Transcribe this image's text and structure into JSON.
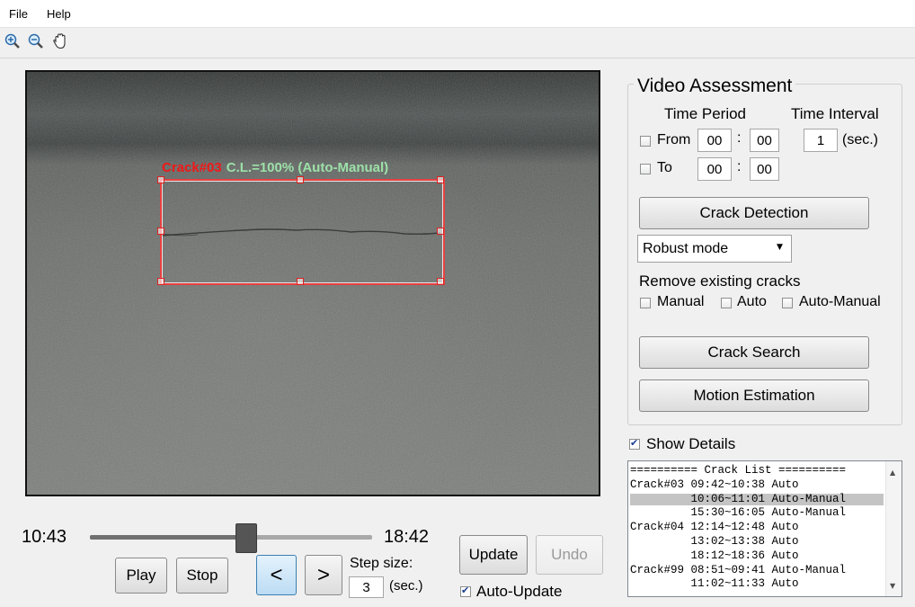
{
  "menu": {
    "file": "File",
    "help": "Help"
  },
  "toolbar": {
    "zoom_in": "zoom-in-icon",
    "zoom_out": "zoom-out-icon",
    "pan": "hand-pan-icon"
  },
  "video": {
    "overlay_id": "Crack#03",
    "overlay_cl": "C.L.=100% (Auto-Manual)",
    "overlay_color_id": "#f01818",
    "overlay_color_cl": "#9ce0a8"
  },
  "playback": {
    "current_time": "10:43",
    "end_time": "18:42",
    "slider_position": 0.55,
    "play": "Play",
    "stop": "Stop",
    "prev": "<",
    "next": ">",
    "step_label": "Step size:",
    "step_value": "3",
    "step_unit": "(sec.)",
    "update": "Update",
    "undo": "Undo",
    "auto_update": "Auto-Update",
    "auto_update_checked": true
  },
  "assessment": {
    "title": "Video Assessment",
    "time_period": "Time Period",
    "time_interval": "Time Interval",
    "from_label": "From",
    "from_min": "00",
    "from_sec": "00",
    "to_label": "To",
    "to_min": "00",
    "to_sec": "00",
    "colon": ":",
    "interval_value": "1",
    "interval_unit": "(sec.)",
    "crack_detection": "Crack Detection",
    "mode_selected": "Robust mode",
    "remove_label": "Remove existing cracks",
    "remove_manual": "Manual",
    "remove_auto": "Auto",
    "remove_auto_manual": "Auto-Manual",
    "crack_search": "Crack Search",
    "motion_estimation": "Motion Estimation"
  },
  "details": {
    "show_details": "Show Details",
    "show_details_checked": true,
    "rows": [
      "========== Crack List ==========",
      "Crack#03 09:42~10:38 Auto",
      "         10:06~11:01 Auto-Manual",
      "         15:30~16:05 Auto-Manual",
      "Crack#04 12:14~12:48 Auto",
      "         13:02~13:38 Auto",
      "         18:12~18:36 Auto",
      "Crack#99 08:51~09:41 Auto-Manual",
      "         11:02~11:33 Auto"
    ],
    "selected_row": 2
  }
}
